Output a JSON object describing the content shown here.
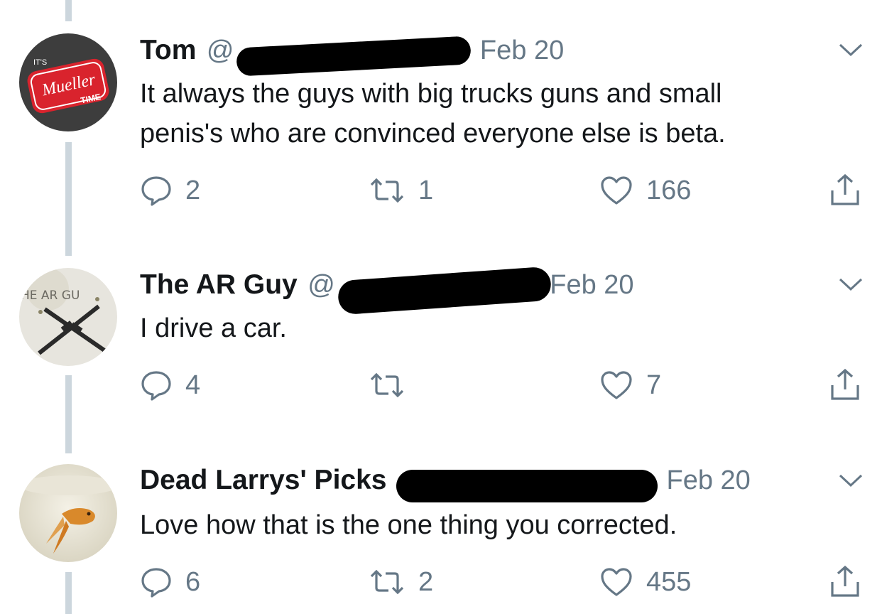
{
  "tweets": [
    {
      "name": "Tom",
      "handle_prefix": "@",
      "date": "Feb 20",
      "text_lines": [
        "It always the guys with big trucks guns and small",
        "penis's who are convinced everyone else is beta."
      ],
      "replies": "2",
      "retweets": "1",
      "likes": "166",
      "avatar_text": {
        "top": "IT'S",
        "brand": "Mueller",
        "bottom": "TIME"
      }
    },
    {
      "name": "The AR Guy",
      "handle_prefix": "@",
      "date": "Feb 20",
      "text_lines": [
        "I drive a car."
      ],
      "replies": "4",
      "retweets": "",
      "likes": "7",
      "avatar_text": {
        "top": "HE AR GU"
      }
    },
    {
      "name": "Dead Larrys' Picks",
      "handle_prefix": "",
      "date": "Feb 20",
      "text_lines": [
        "Love how that is the one thing you corrected."
      ],
      "replies": "6",
      "retweets": "2",
      "likes": "455"
    }
  ],
  "icons": {
    "reply": "speech-bubble-icon",
    "retweet": "retweet-arrows-icon",
    "like": "heart-outline-icon",
    "share": "share-upload-icon",
    "more": "chevron-down-icon"
  },
  "colors": {
    "text": "#14171a",
    "secondary": "#657786",
    "thread_line": "#ccd6dd",
    "redaction": "#000000"
  }
}
